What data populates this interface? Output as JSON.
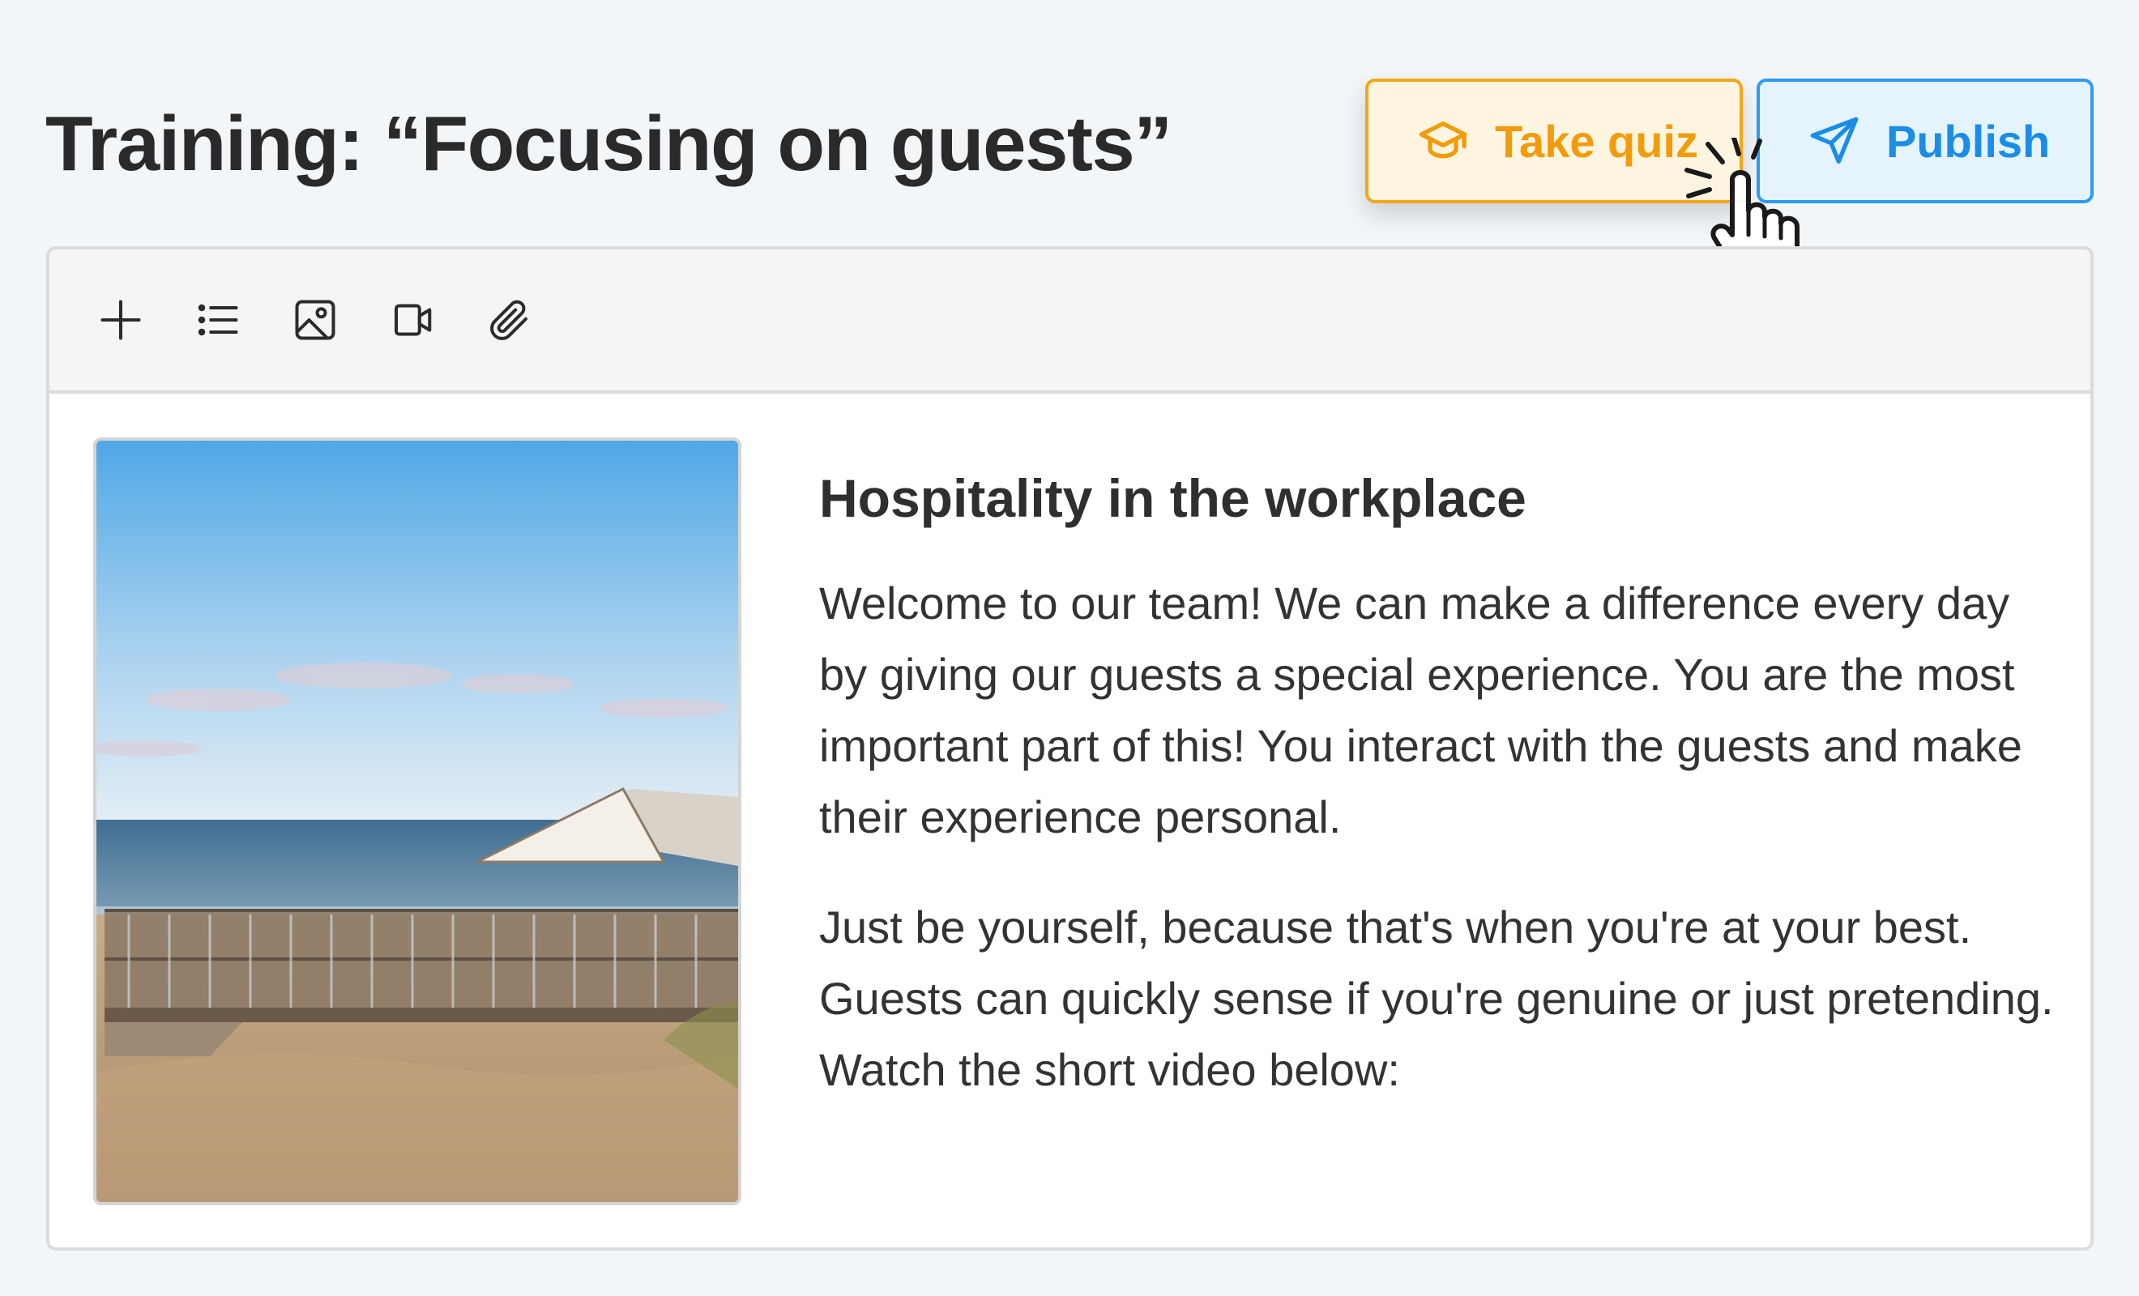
{
  "page": {
    "title": "Training: “Focusing on guests”"
  },
  "header_actions": {
    "take_quiz_label": "Take quiz",
    "publish_label": "Publish"
  },
  "toolbar": {
    "tools": [
      "plus-icon",
      "list-icon",
      "image-icon",
      "video-icon",
      "paperclip-icon"
    ]
  },
  "article": {
    "heading": "Hospitality in the workplace",
    "paragraph_1": "Welcome to our team! We can make a difference every day by giving our guests a special experience. You are the most important part of this! You interact with the guests and make their experience personal.",
    "paragraph_2": "Just be yourself, because that's when you're at your best. Guests can quickly sense if you're genuine or just pretending. Watch the short video below:"
  },
  "colors": {
    "quiz_accent": "#f29c0b",
    "quiz_bg": "#fef5e0",
    "publish_accent": "#1a8de6",
    "publish_bg": "#e5f3fd",
    "page_bg": "#f3f6f9"
  }
}
